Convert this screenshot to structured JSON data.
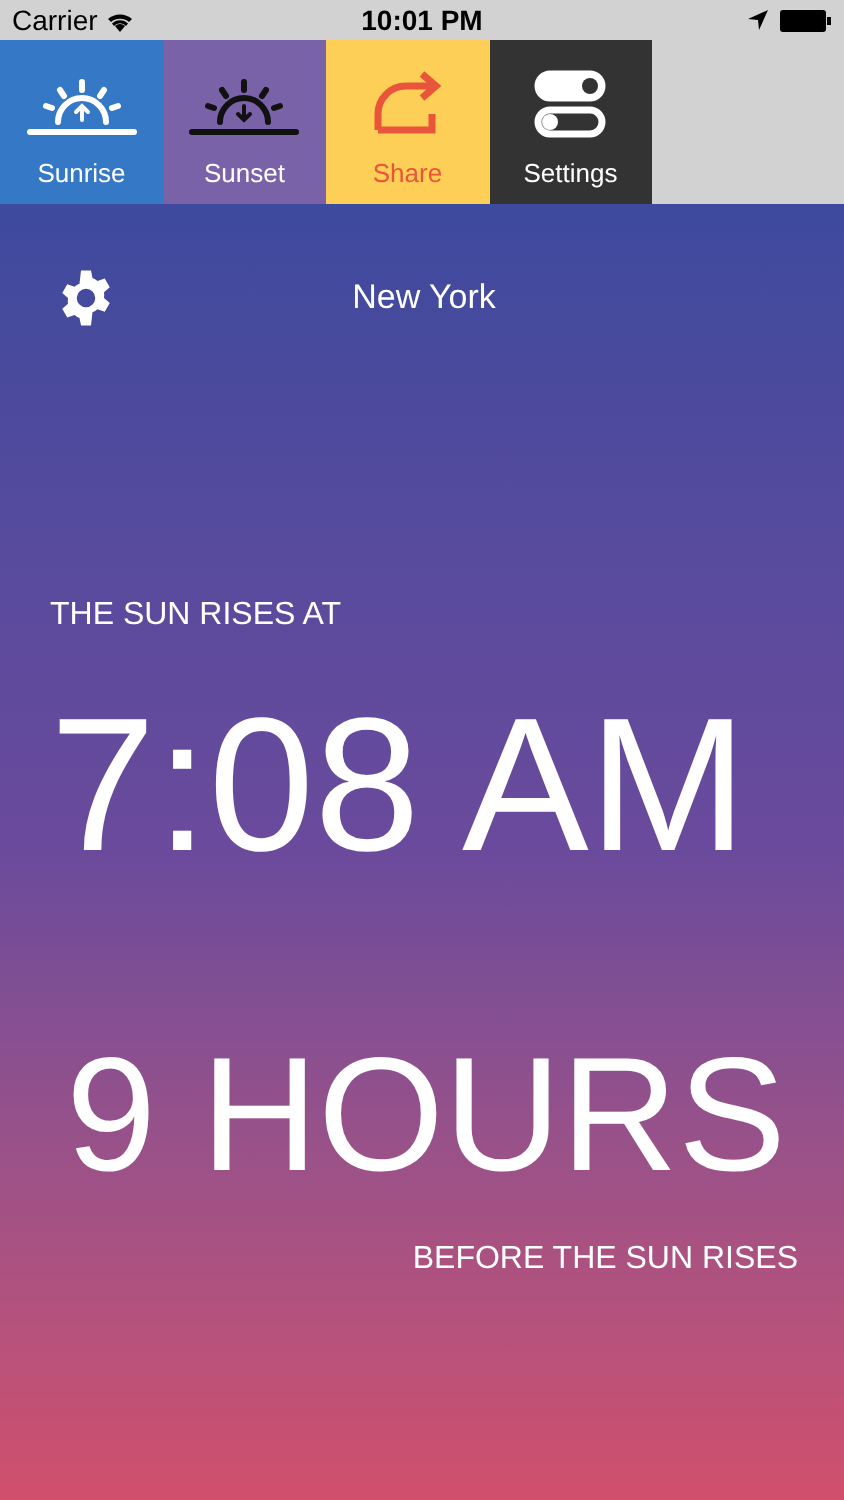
{
  "status_bar": {
    "carrier": "Carrier",
    "time": "10:01 PM"
  },
  "tabs": [
    {
      "kind": "sunrise",
      "label": "Sunrise",
      "color": "#3478c6"
    },
    {
      "kind": "sunset",
      "label": "Sunset",
      "color": "#7a62a8"
    },
    {
      "kind": "share",
      "label": "Share",
      "color": "#fdcf56"
    },
    {
      "kind": "settings",
      "label": "Settings",
      "color": "#333333"
    }
  ],
  "location": "New York",
  "caption": "THE SUN RISES AT",
  "time": "7:08 AM",
  "countdown": "9 HOURS",
  "footer": "BEFORE THE SUN RISES"
}
